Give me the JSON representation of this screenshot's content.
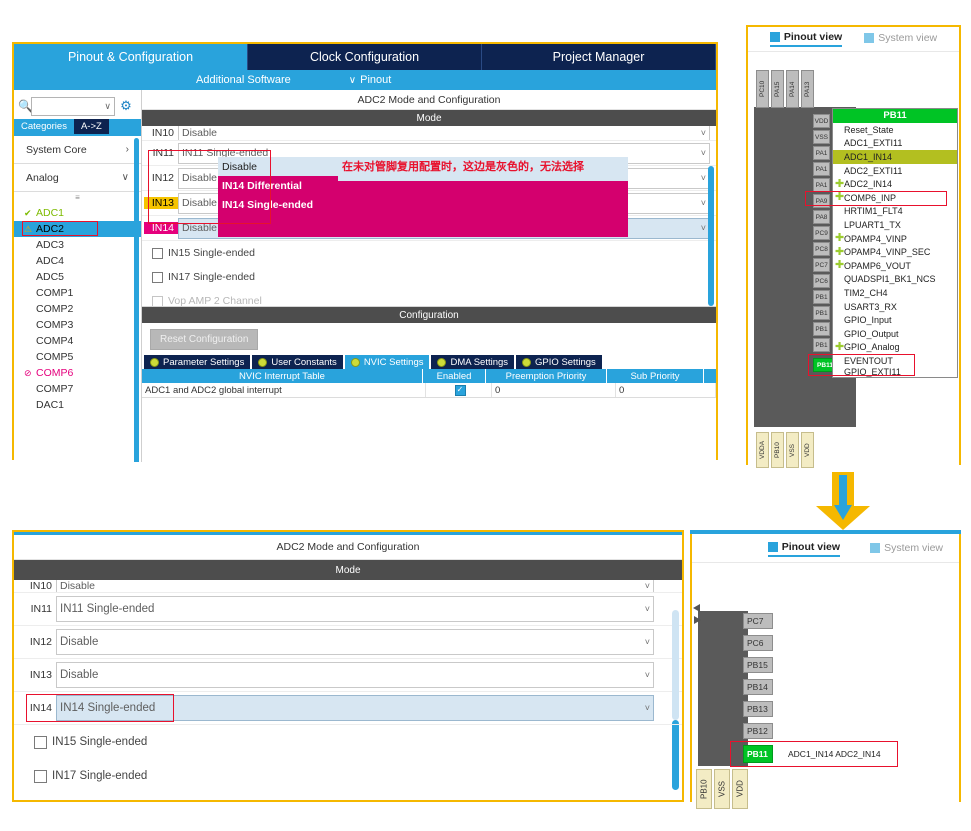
{
  "app": {
    "main_tabs": [
      {
        "label": "Pinout & Configuration",
        "active": true
      },
      {
        "label": "Clock Configuration",
        "active": false
      },
      {
        "label": "Project Manager",
        "active": false
      }
    ],
    "subbar": {
      "additional_software": "Additional Software",
      "chevron": "∨",
      "pinout": "Pinout"
    }
  },
  "sidebar": {
    "search": {
      "icon": "search-icon",
      "placeholder": "",
      "value": "",
      "chevron": "∨"
    },
    "gear_icon": "gear-icon",
    "cat_tabs": [
      {
        "label": "Categories",
        "selected": false
      },
      {
        "label": "A->Z",
        "selected": true
      }
    ],
    "groups": [
      {
        "label": "System Core",
        "arrow": "›"
      },
      {
        "label": "Analog",
        "arrow": "∨"
      }
    ],
    "spinner": "≡",
    "items": [
      {
        "label": "ADC1",
        "icon": "✔",
        "state": "ok",
        "selected": false
      },
      {
        "label": "ADC2",
        "icon": "⚠",
        "state": "warning",
        "selected": true
      },
      {
        "label": "ADC3",
        "icon": "",
        "state": "none",
        "selected": false
      },
      {
        "label": "ADC4",
        "icon": "",
        "state": "none",
        "selected": false
      },
      {
        "label": "ADC5",
        "icon": "",
        "state": "none",
        "selected": false
      },
      {
        "label": "COMP1",
        "icon": "",
        "state": "none",
        "selected": false
      },
      {
        "label": "COMP2",
        "icon": "",
        "state": "none",
        "selected": false
      },
      {
        "label": "COMP3",
        "icon": "",
        "state": "none",
        "selected": false
      },
      {
        "label": "COMP4",
        "icon": "",
        "state": "none",
        "selected": false
      },
      {
        "label": "COMP5",
        "icon": "",
        "state": "none",
        "selected": false
      },
      {
        "label": "COMP6",
        "icon": "⊘",
        "state": "blocked",
        "selected": false
      },
      {
        "label": "COMP7",
        "icon": "",
        "state": "none",
        "selected": false
      },
      {
        "label": "DAC1",
        "icon": "",
        "state": "none",
        "selected": false
      }
    ]
  },
  "top_panel": {
    "title": "ADC2 Mode and Configuration",
    "mode_header": "Mode",
    "channels": [
      {
        "label": "IN10",
        "value": "Disable",
        "highlight": "none",
        "clipped": true
      },
      {
        "label": "IN11",
        "value": "IN11 Single-ended",
        "highlight": "none"
      },
      {
        "label": "IN12",
        "value": "Disable",
        "highlight": "none"
      },
      {
        "label": "IN13",
        "value": "Disable",
        "highlight": "yellow"
      },
      {
        "label": "IN14",
        "value": "Disable",
        "highlight": "pink"
      }
    ],
    "checkboxes": [
      {
        "label": "IN15 Single-ended",
        "checked": false
      },
      {
        "label": "IN17 Single-ended",
        "checked": false
      },
      {
        "label": "Vop AMP 2 Channel",
        "checked": false,
        "dim": true
      }
    ],
    "dropdown_options": [
      {
        "label": "Disable",
        "style": "light"
      },
      {
        "label": "IN14 Differential",
        "style": "pink"
      },
      {
        "label": "IN14 Single-ended",
        "style": "pink"
      }
    ],
    "annotation": "在未对管脚复用配置时，这边是灰色的，无法选择",
    "configuration_header": "Configuration",
    "reset_button": "Reset Configuration",
    "config_tabs": [
      {
        "label": "Parameter Settings",
        "active": false
      },
      {
        "label": "User Constants",
        "active": false
      },
      {
        "label": "NVIC Settings",
        "active": true
      },
      {
        "label": "DMA Settings",
        "active": false
      },
      {
        "label": "GPIO Settings",
        "active": false
      }
    ],
    "nvic_table": {
      "headers": [
        "NVIC Interrupt Table",
        "Enabled",
        "Preemption Priority",
        "Sub Priority"
      ],
      "rows": [
        {
          "name": "ADC1 and ADC2 global interrupt",
          "enabled": true,
          "preemption": "0",
          "sub": "0"
        }
      ]
    }
  },
  "bottom_panel": {
    "title": "ADC2 Mode and Configuration",
    "mode_header": "Mode",
    "channels": [
      {
        "label": "IN10",
        "value": "Disable",
        "highlight": "none",
        "clipped": true
      },
      {
        "label": "IN11",
        "value": "IN11 Single-ended",
        "highlight": "none"
      },
      {
        "label": "IN12",
        "value": "Disable",
        "highlight": "none"
      },
      {
        "label": "IN13",
        "value": "Disable",
        "highlight": "none"
      },
      {
        "label": "IN14",
        "value": "IN14 Single-ended",
        "highlight": "selected"
      }
    ],
    "checkboxes": [
      {
        "label": "IN15 Single-ended",
        "checked": false
      },
      {
        "label": "IN17 Single-ended",
        "checked": false
      }
    ]
  },
  "pinout_top": {
    "tabs": [
      {
        "label": "Pinout view",
        "active": true,
        "icon": "chip-icon"
      },
      {
        "label": "System view",
        "active": false,
        "icon": "grid-icon"
      }
    ],
    "top_pins": [
      "PC10",
      "PA15",
      "PA14",
      "PA13"
    ],
    "right_pins": [
      "VDD",
      "VSS",
      "PA1",
      "PA1",
      "PA1",
      "PA9",
      "PA8",
      "PC9",
      "PC8",
      "PC7",
      "PC6",
      "PB1",
      "PB1",
      "PB1",
      "PB1"
    ],
    "bottom_pins": [
      "VDDA",
      "PB10",
      "VSS",
      "VDD"
    ],
    "selected_pin": "PB11",
    "selected_pin_label": "ADC1_IN14",
    "menu": {
      "header": "PB11",
      "items": [
        {
          "label": "Reset_State",
          "plus": false,
          "highlight": false
        },
        {
          "label": "ADC1_EXTI11",
          "plus": false,
          "highlight": false
        },
        {
          "label": "ADC1_IN14",
          "plus": false,
          "highlight": true
        },
        {
          "label": "ADC2_EXTI11",
          "plus": false,
          "highlight": false
        },
        {
          "label": "ADC2_IN14",
          "plus": true,
          "highlight": false
        },
        {
          "label": "COMP6_INP",
          "plus": true,
          "highlight": false
        },
        {
          "label": "HRTIM1_FLT4",
          "plus": false,
          "highlight": false
        },
        {
          "label": "LPUART1_TX",
          "plus": false,
          "highlight": false
        },
        {
          "label": "OPAMP4_VINP",
          "plus": true,
          "highlight": false
        },
        {
          "label": "OPAMP4_VINP_SEC",
          "plus": true,
          "highlight": false
        },
        {
          "label": "OPAMP6_VOUT",
          "plus": true,
          "highlight": false
        },
        {
          "label": "QUADSPI1_BK1_NCS",
          "plus": false,
          "highlight": false
        },
        {
          "label": "TIM2_CH4",
          "plus": false,
          "highlight": false
        },
        {
          "label": "USART3_RX",
          "plus": false,
          "highlight": false
        },
        {
          "label": "GPIO_Input",
          "plus": false,
          "highlight": false
        },
        {
          "label": "GPIO_Output",
          "plus": false,
          "highlight": false
        },
        {
          "label": "GPIO_Analog",
          "plus": true,
          "highlight": false
        },
        {
          "label": "EVENTOUT",
          "plus": false,
          "highlight": false
        },
        {
          "label": "GPIO_EXTI11",
          "plus": false,
          "highlight": false
        }
      ]
    }
  },
  "pinout_bottom": {
    "tabs": [
      {
        "label": "Pinout view",
        "active": true,
        "icon": "chip-icon"
      },
      {
        "label": "System view",
        "active": false,
        "icon": "grid-icon"
      }
    ],
    "right_pins": [
      "PC7",
      "PC6",
      "PB15",
      "PB14",
      "PB13",
      "PB12"
    ],
    "bottom_pins": [
      "PB10",
      "VSS",
      "VDD"
    ],
    "selected_pin": "PB11",
    "selected_pin_label": "ADC1_IN14 ADC2_IN14"
  },
  "colors": {
    "accent_blue": "#29a3dc",
    "dark_navy": "#0d2350",
    "gold_border": "#f5b800",
    "red_mark": "#e8112d",
    "pink": "#d4006e",
    "green_pin": "#00c425",
    "olive_highlight": "#b3bf20"
  }
}
